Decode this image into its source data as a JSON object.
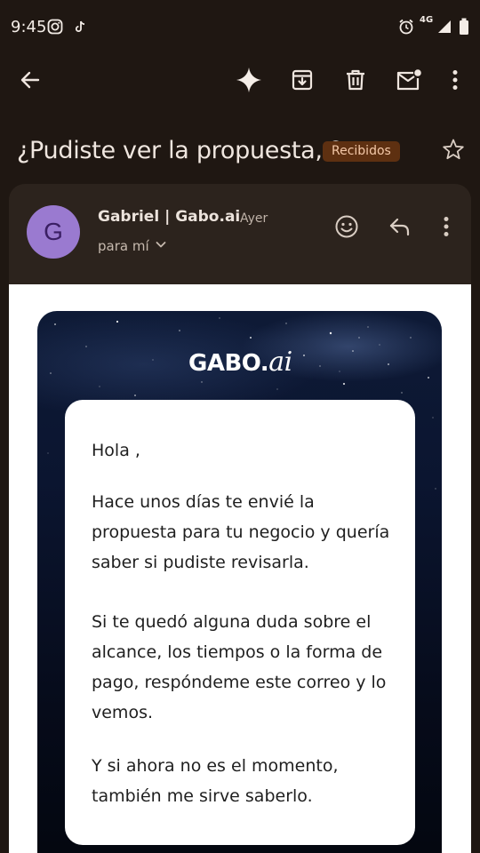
{
  "status_bar": {
    "time": "9:45",
    "network": "4G",
    "icons": [
      "instagram-icon",
      "tiktok-icon",
      "alarm-icon",
      "signal-icon",
      "battery-icon"
    ]
  },
  "toolbar": {
    "icons": [
      "back-arrow-icon",
      "gemini-sparkle-icon",
      "archive-icon",
      "delete-icon",
      "mark-unread-icon",
      "more-vert-icon"
    ]
  },
  "email": {
    "subject": "¿Pudiste ver la propuesta, ?",
    "label": "Recibidos",
    "sender": {
      "avatar_letter": "G",
      "name": "Gabriel | Gabo.ai",
      "date": "Ayer",
      "recipient": "para mí"
    },
    "brand": {
      "main": "GABO.",
      "suffix": "ai"
    },
    "body": {
      "greeting": "Hola ,",
      "paragraph_1_line_1": "Hace unos días te envié la",
      "paragraph_1_line_2": "propuesta para tu negocio y quería",
      "paragraph_1_line_3": "saber si pudiste revisarla.",
      "paragraph_2_line_1": "Si te quedó alguna duda sobre el",
      "paragraph_2_line_2": "alcance, los tiempos o la forma de",
      "paragraph_2_line_3": "pago, respóndeme este correo y lo",
      "paragraph_2_line_4": "vemos.",
      "paragraph_3_line_1": "Y si ahora no es el momento,",
      "paragraph_3_line_2": "también me sirve saberlo."
    }
  },
  "colors": {
    "background": "#1f1712",
    "card": "#2c231d",
    "label_chip": "#5e3011",
    "avatar": "#9a7ad0"
  }
}
